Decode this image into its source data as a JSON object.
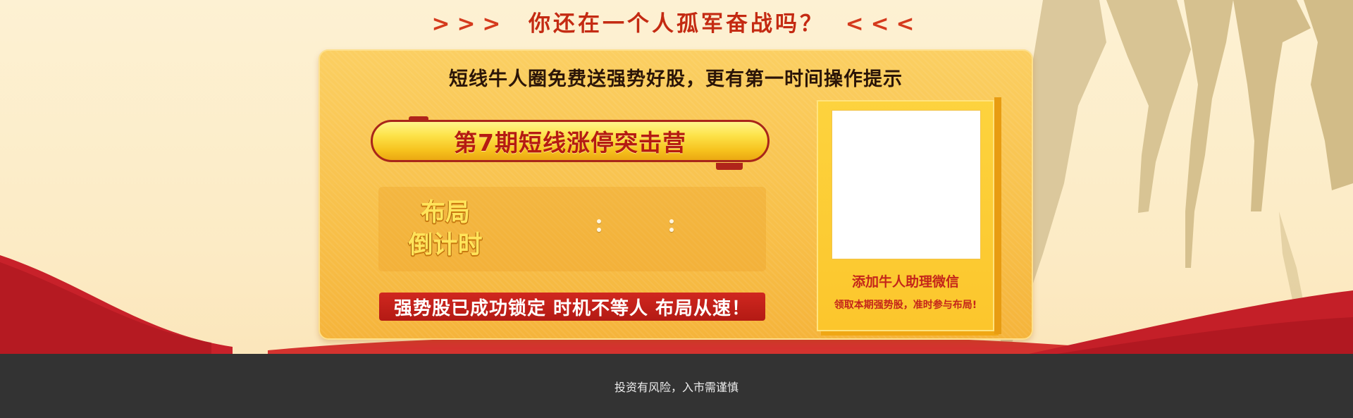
{
  "hero": {
    "arrows_left": ">>>",
    "headline": "你还在一个人孤军奋战吗？",
    "arrows_right": "<<<"
  },
  "panel": {
    "subtitle": "短线牛人圈免费送强势好股，更有第一时间操作提示",
    "campaign_title": "第7期短线涨停突击营",
    "countdown": {
      "label_line1": "布局",
      "label_line2": "倒计时"
    },
    "slogan": "强势股已成功锁定 时机不等人 布局从速！"
  },
  "qr_card": {
    "title": "添加牛人助理微信",
    "subtitle": "领取本期强势股，准时参与布局!"
  },
  "footer": {
    "risk_notice": "投资有风险，入市需谨慎"
  },
  "colors": {
    "accent_red": "#c42a12",
    "panel_yellow": "#f8c04a",
    "footer_bg": "#333333"
  }
}
